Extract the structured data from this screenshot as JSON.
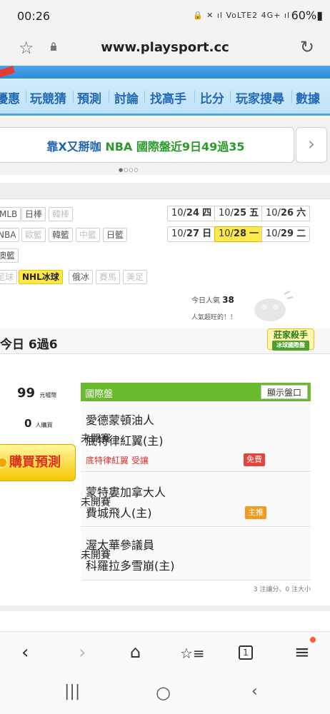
{
  "status_bar": {
    "time": "00:26",
    "icons": "🔒 ✕ ıl VoLTE2 4G+ ıl",
    "battery": "60%▮"
  },
  "browser": {
    "url": "www.playsport.cc"
  },
  "nav": {
    "tabs": [
      "優惠",
      "玩競猜",
      "預測",
      "討論",
      "找高手",
      "比分",
      "玩家搜尋",
      "數據"
    ]
  },
  "banner": {
    "part_a": "靠X又掰咖",
    "part_b": "NBA 國際盤近9日49過35",
    "next_arrow": "›",
    "dots": "●○○○"
  },
  "leagues": {
    "row1": [
      {
        "label": "MLB",
        "state": "normal"
      },
      {
        "label": "日棒",
        "state": "normal"
      },
      {
        "label": "韓棒",
        "state": "dim"
      }
    ],
    "row2": [
      {
        "label": "NBA",
        "state": "normal"
      },
      {
        "label": "歐籃",
        "state": "dim"
      },
      {
        "label": "韓籃",
        "state": "normal"
      },
      {
        "label": "中籃",
        "state": "dim"
      },
      {
        "label": "日籃",
        "state": "normal"
      }
    ],
    "row3": [
      {
        "label": "澳籃",
        "state": "normal"
      }
    ],
    "row4": [
      {
        "label": "足球",
        "state": "dim"
      },
      {
        "label": "NHL冰球",
        "state": "selected"
      },
      {
        "label": "俄冰",
        "state": "normal"
      },
      {
        "label": "賽馬",
        "state": "dim"
      },
      {
        "label": "美足",
        "state": "dim"
      }
    ]
  },
  "dates": [
    {
      "prefix": "10/",
      "day": "24",
      "weekday": "四",
      "selected": false
    },
    {
      "prefix": "10/",
      "day": "25",
      "weekday": "五",
      "selected": false
    },
    {
      "prefix": "10/",
      "day": "26",
      "weekday": "六",
      "selected": false
    },
    {
      "prefix": "10/",
      "day": "27",
      "weekday": "日",
      "selected": false
    },
    {
      "prefix": "10/",
      "day": "28",
      "weekday": "一",
      "selected": true
    },
    {
      "prefix": "10/",
      "day": "29",
      "weekday": "二",
      "selected": false
    }
  ],
  "popularity": {
    "label": "今日人氣",
    "value": "38",
    "sub": "人氣超旺的！！"
  },
  "today_record": "今日 6過6",
  "badge": {
    "title": "莊家殺手",
    "sub": "冰球國際盤"
  },
  "prediction": {
    "price": "99",
    "price_unit": "元噓幣",
    "buyers": "0",
    "buyers_unit": "人購買",
    "buy_label": "購買預測"
  },
  "table": {
    "header": "國際盤",
    "show_button": "顯示盤口",
    "games": [
      {
        "away": "愛德蒙頓油人",
        "home": "底特律紅翼(主)",
        "handicap": "底特律紅翼 受讓",
        "tag": "免費",
        "status": "未開賽"
      },
      {
        "away": "蒙特婁加拿大人",
        "home": "費城飛人(主)",
        "handicap": "",
        "tag": "主推",
        "status": "未開賽"
      },
      {
        "away": "渥太華參議員",
        "home": "科羅拉多雪崩(主)",
        "handicap": "",
        "tag": "",
        "status": "未開賽"
      }
    ],
    "note": "3 注讓分、0 注大小"
  },
  "toolbar": {
    "back": "‹",
    "forward": "›",
    "home": "⌂",
    "bookmarks": "☆≡",
    "tabs_count": "1",
    "menu": "≡"
  },
  "system_nav": {
    "recents": "|||",
    "home": "○",
    "back": "‹"
  }
}
